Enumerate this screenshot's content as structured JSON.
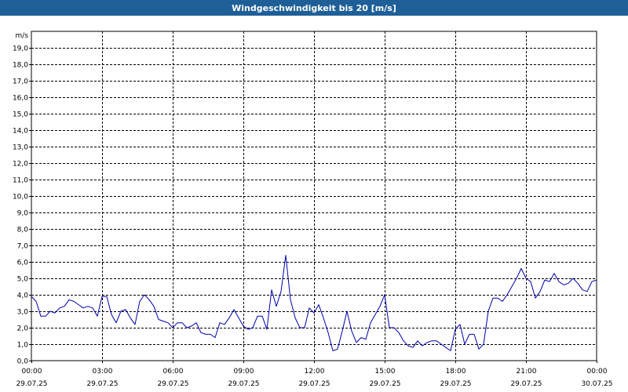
{
  "window": {
    "title": "Windgeschwindigkeit bis 20 [m/s]"
  },
  "colors": {
    "titlebar_bg": "#1e5f98",
    "series": "#0000aa",
    "grid": "#000000"
  },
  "chart_data": {
    "type": "line",
    "title": "Windgeschwindigkeit bis 20 [m/s]",
    "ylabel": "m/s",
    "xlabel": "",
    "ylim": [
      0,
      20
    ],
    "xlim_hours": [
      0,
      24
    ],
    "grid": true,
    "y_ticks": [
      "0,0",
      "1,0",
      "2,0",
      "3,0",
      "4,0",
      "5,0",
      "6,0",
      "7,0",
      "8,0",
      "9,0",
      "10,0",
      "11,0",
      "12,0",
      "13,0",
      "14,0",
      "15,0",
      "16,0",
      "17,0",
      "18,0",
      "19,0"
    ],
    "x_ticks": [
      {
        "time": "00:00",
        "date": "29.07.25"
      },
      {
        "time": "03:00",
        "date": "29.07.25"
      },
      {
        "time": "06:00",
        "date": "29.07.25"
      },
      {
        "time": "09:00",
        "date": "29.07.25"
      },
      {
        "time": "12:00",
        "date": "29.07.25"
      },
      {
        "time": "15:00",
        "date": "29.07.25"
      },
      {
        "time": "18:00",
        "date": "29.07.25"
      },
      {
        "time": "21:00",
        "date": "29.07.25"
      },
      {
        "time": "00:00",
        "date": "30.07.25"
      }
    ],
    "series": [
      {
        "x_hours": [
          0.0,
          0.2,
          0.4,
          0.6,
          0.8,
          1.0,
          1.2,
          1.4,
          1.6,
          1.8,
          2.0,
          2.2,
          2.4,
          2.6,
          2.8,
          3.0,
          3.2,
          3.4,
          3.6,
          3.8,
          4.0,
          4.2,
          4.4,
          4.6,
          4.8,
          5.0,
          5.2,
          5.4,
          5.6,
          5.8,
          6.0,
          6.2,
          6.4,
          6.6,
          6.8,
          7.0,
          7.2,
          7.4,
          7.6,
          7.8,
          8.0,
          8.2,
          8.4,
          8.6,
          8.8,
          9.0,
          9.2,
          9.4,
          9.6,
          9.8,
          10.0,
          10.2,
          10.4,
          10.6,
          10.8,
          11.0,
          11.2,
          11.4,
          11.6,
          11.8,
          12.0,
          12.2,
          12.4,
          12.6,
          12.8,
          13.0,
          13.2,
          13.4,
          13.6,
          13.8,
          14.0,
          14.2,
          14.4,
          14.6,
          14.8,
          15.0,
          15.2,
          15.4,
          15.6,
          15.8,
          16.0,
          16.2,
          16.4,
          16.6,
          16.8,
          17.0,
          17.2,
          17.4,
          17.6,
          17.8,
          18.0,
          18.2,
          18.4,
          18.6,
          18.8,
          19.0,
          19.2,
          19.4,
          19.6,
          19.8,
          20.0,
          20.2,
          20.4,
          20.6,
          20.8,
          21.0,
          21.2,
          21.4,
          21.6,
          21.8,
          22.0,
          22.2,
          22.4,
          22.6,
          22.8,
          23.0,
          23.2,
          23.4,
          23.6,
          23.8,
          24.0
        ],
        "values": [
          3.9,
          3.6,
          2.7,
          2.7,
          3.0,
          2.9,
          3.2,
          3.3,
          3.7,
          3.6,
          3.4,
          3.2,
          3.3,
          3.2,
          2.7,
          3.9,
          3.9,
          2.8,
          2.3,
          3.0,
          3.1,
          2.6,
          2.2,
          3.6,
          4.0,
          3.7,
          3.3,
          2.5,
          2.4,
          2.3,
          2.0,
          2.3,
          2.3,
          2.0,
          2.1,
          2.3,
          1.7,
          1.6,
          1.6,
          1.4,
          2.3,
          2.2,
          2.6,
          3.1,
          2.6,
          2.1,
          1.9,
          2.0,
          2.7,
          2.7,
          1.9,
          4.3,
          3.3,
          4.2,
          6.4,
          3.7,
          2.6,
          2.0,
          2.0,
          3.2,
          2.9,
          3.4,
          2.6,
          1.7,
          0.6,
          0.7,
          1.8,
          3.0,
          1.8,
          1.1,
          1.4,
          1.3,
          2.3,
          2.8,
          3.3,
          4.0,
          2.0,
          2.0,
          1.7,
          1.2,
          0.9,
          0.8,
          1.2,
          0.9,
          1.1,
          1.2,
          1.2,
          1.0,
          0.8,
          0.6,
          1.9,
          2.2,
          1.0,
          1.6,
          1.6,
          0.7,
          1.0,
          3.0,
          3.8,
          3.8,
          3.6,
          4.0,
          4.5,
          5.0,
          5.6,
          5.0,
          4.8,
          3.8,
          4.2,
          4.9,
          4.8,
          5.3,
          4.8,
          4.6,
          4.7,
          5.0,
          4.7,
          4.3,
          4.2,
          4.8,
          4.9,
          5.1,
          5.0,
          5.2,
          5.2
        ]
      }
    ]
  }
}
